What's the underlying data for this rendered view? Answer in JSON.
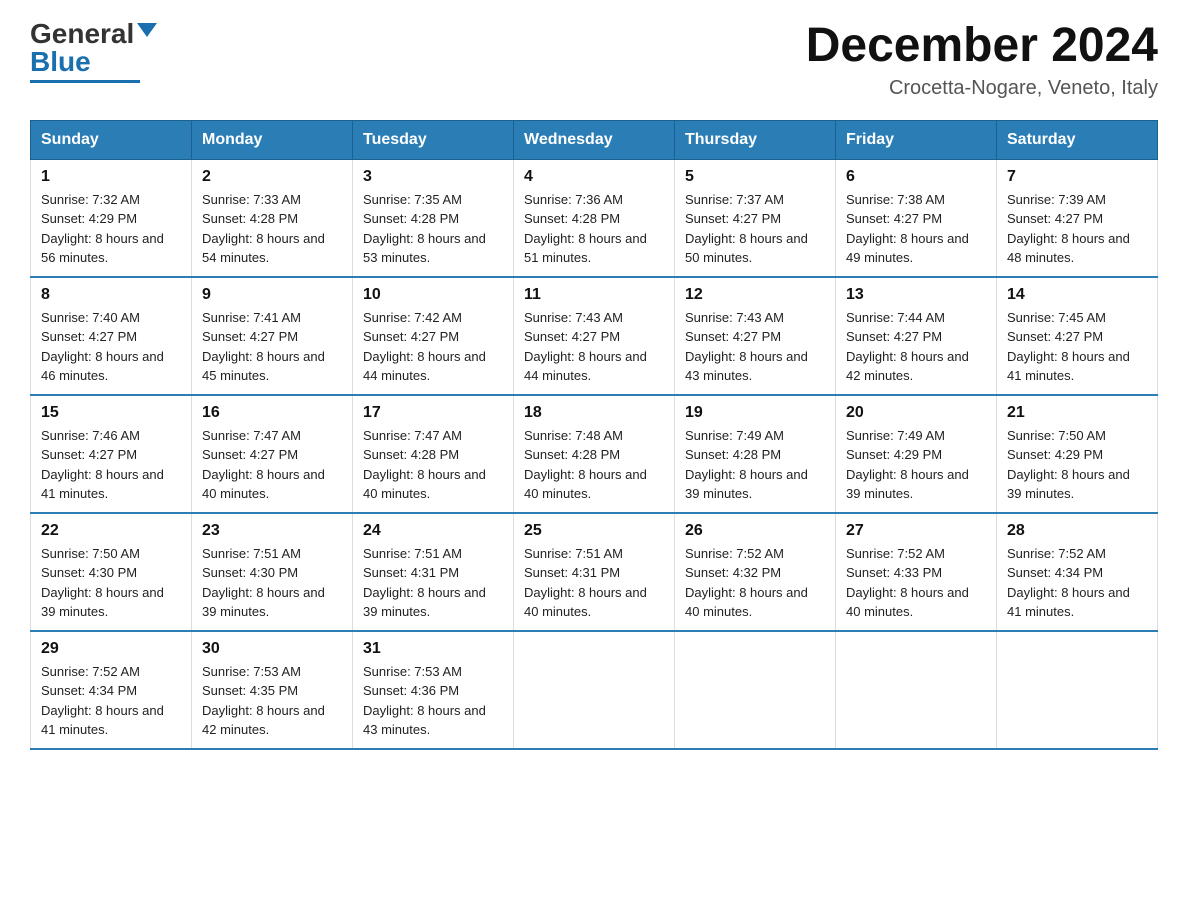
{
  "header": {
    "logo_general": "General",
    "logo_blue": "Blue",
    "month_title": "December 2024",
    "location": "Crocetta-Nogare, Veneto, Italy"
  },
  "days_of_week": [
    "Sunday",
    "Monday",
    "Tuesday",
    "Wednesday",
    "Thursday",
    "Friday",
    "Saturday"
  ],
  "weeks": [
    [
      {
        "num": "1",
        "sunrise": "7:32 AM",
        "sunset": "4:29 PM",
        "daylight": "8 hours and 56 minutes."
      },
      {
        "num": "2",
        "sunrise": "7:33 AM",
        "sunset": "4:28 PM",
        "daylight": "8 hours and 54 minutes."
      },
      {
        "num": "3",
        "sunrise": "7:35 AM",
        "sunset": "4:28 PM",
        "daylight": "8 hours and 53 minutes."
      },
      {
        "num": "4",
        "sunrise": "7:36 AM",
        "sunset": "4:28 PM",
        "daylight": "8 hours and 51 minutes."
      },
      {
        "num": "5",
        "sunrise": "7:37 AM",
        "sunset": "4:27 PM",
        "daylight": "8 hours and 50 minutes."
      },
      {
        "num": "6",
        "sunrise": "7:38 AM",
        "sunset": "4:27 PM",
        "daylight": "8 hours and 49 minutes."
      },
      {
        "num": "7",
        "sunrise": "7:39 AM",
        "sunset": "4:27 PM",
        "daylight": "8 hours and 48 minutes."
      }
    ],
    [
      {
        "num": "8",
        "sunrise": "7:40 AM",
        "sunset": "4:27 PM",
        "daylight": "8 hours and 46 minutes."
      },
      {
        "num": "9",
        "sunrise": "7:41 AM",
        "sunset": "4:27 PM",
        "daylight": "8 hours and 45 minutes."
      },
      {
        "num": "10",
        "sunrise": "7:42 AM",
        "sunset": "4:27 PM",
        "daylight": "8 hours and 44 minutes."
      },
      {
        "num": "11",
        "sunrise": "7:43 AM",
        "sunset": "4:27 PM",
        "daylight": "8 hours and 44 minutes."
      },
      {
        "num": "12",
        "sunrise": "7:43 AM",
        "sunset": "4:27 PM",
        "daylight": "8 hours and 43 minutes."
      },
      {
        "num": "13",
        "sunrise": "7:44 AM",
        "sunset": "4:27 PM",
        "daylight": "8 hours and 42 minutes."
      },
      {
        "num": "14",
        "sunrise": "7:45 AM",
        "sunset": "4:27 PM",
        "daylight": "8 hours and 41 minutes."
      }
    ],
    [
      {
        "num": "15",
        "sunrise": "7:46 AM",
        "sunset": "4:27 PM",
        "daylight": "8 hours and 41 minutes."
      },
      {
        "num": "16",
        "sunrise": "7:47 AM",
        "sunset": "4:27 PM",
        "daylight": "8 hours and 40 minutes."
      },
      {
        "num": "17",
        "sunrise": "7:47 AM",
        "sunset": "4:28 PM",
        "daylight": "8 hours and 40 minutes."
      },
      {
        "num": "18",
        "sunrise": "7:48 AM",
        "sunset": "4:28 PM",
        "daylight": "8 hours and 40 minutes."
      },
      {
        "num": "19",
        "sunrise": "7:49 AM",
        "sunset": "4:28 PM",
        "daylight": "8 hours and 39 minutes."
      },
      {
        "num": "20",
        "sunrise": "7:49 AM",
        "sunset": "4:29 PM",
        "daylight": "8 hours and 39 minutes."
      },
      {
        "num": "21",
        "sunrise": "7:50 AM",
        "sunset": "4:29 PM",
        "daylight": "8 hours and 39 minutes."
      }
    ],
    [
      {
        "num": "22",
        "sunrise": "7:50 AM",
        "sunset": "4:30 PM",
        "daylight": "8 hours and 39 minutes."
      },
      {
        "num": "23",
        "sunrise": "7:51 AM",
        "sunset": "4:30 PM",
        "daylight": "8 hours and 39 minutes."
      },
      {
        "num": "24",
        "sunrise": "7:51 AM",
        "sunset": "4:31 PM",
        "daylight": "8 hours and 39 minutes."
      },
      {
        "num": "25",
        "sunrise": "7:51 AM",
        "sunset": "4:31 PM",
        "daylight": "8 hours and 40 minutes."
      },
      {
        "num": "26",
        "sunrise": "7:52 AM",
        "sunset": "4:32 PM",
        "daylight": "8 hours and 40 minutes."
      },
      {
        "num": "27",
        "sunrise": "7:52 AM",
        "sunset": "4:33 PM",
        "daylight": "8 hours and 40 minutes."
      },
      {
        "num": "28",
        "sunrise": "7:52 AM",
        "sunset": "4:34 PM",
        "daylight": "8 hours and 41 minutes."
      }
    ],
    [
      {
        "num": "29",
        "sunrise": "7:52 AM",
        "sunset": "4:34 PM",
        "daylight": "8 hours and 41 minutes."
      },
      {
        "num": "30",
        "sunrise": "7:53 AM",
        "sunset": "4:35 PM",
        "daylight": "8 hours and 42 minutes."
      },
      {
        "num": "31",
        "sunrise": "7:53 AM",
        "sunset": "4:36 PM",
        "daylight": "8 hours and 43 minutes."
      },
      null,
      null,
      null,
      null
    ]
  ]
}
